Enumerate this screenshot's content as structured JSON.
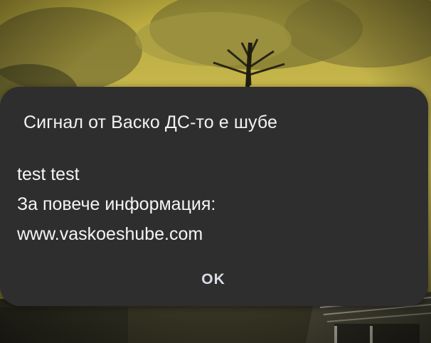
{
  "dialog": {
    "title": "Сигнал от Васко ДС-то е шубе",
    "message_lines": [
      "test test",
      "За повече информация:",
      "www.vaskoeshube.com"
    ],
    "ok_label": "OK"
  },
  "colors": {
    "dialog_background": "#2e2e2e",
    "title_text": "#f2f2f2",
    "body_text": "#f5f5f5",
    "button_text": "#d8dde3",
    "wallpaper_sky": "#c9b94a"
  },
  "icons": {
    "wallpaper": "tree-landscape-image"
  }
}
